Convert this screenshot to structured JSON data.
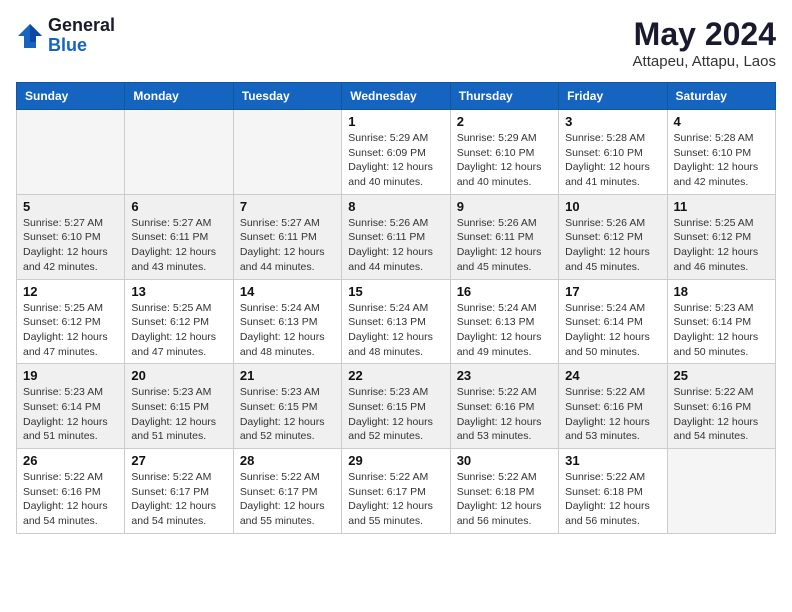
{
  "logo": {
    "general": "General",
    "blue": "Blue"
  },
  "title": "May 2024",
  "subtitle": "Attapeu, Attapu, Laos",
  "days_header": [
    "Sunday",
    "Monday",
    "Tuesday",
    "Wednesday",
    "Thursday",
    "Friday",
    "Saturday"
  ],
  "weeks": [
    [
      {
        "day": "",
        "info": ""
      },
      {
        "day": "",
        "info": ""
      },
      {
        "day": "",
        "info": ""
      },
      {
        "day": "1",
        "info": "Sunrise: 5:29 AM\nSunset: 6:09 PM\nDaylight: 12 hours\nand 40 minutes."
      },
      {
        "day": "2",
        "info": "Sunrise: 5:29 AM\nSunset: 6:10 PM\nDaylight: 12 hours\nand 40 minutes."
      },
      {
        "day": "3",
        "info": "Sunrise: 5:28 AM\nSunset: 6:10 PM\nDaylight: 12 hours\nand 41 minutes."
      },
      {
        "day": "4",
        "info": "Sunrise: 5:28 AM\nSunset: 6:10 PM\nDaylight: 12 hours\nand 42 minutes."
      }
    ],
    [
      {
        "day": "5",
        "info": "Sunrise: 5:27 AM\nSunset: 6:10 PM\nDaylight: 12 hours\nand 42 minutes."
      },
      {
        "day": "6",
        "info": "Sunrise: 5:27 AM\nSunset: 6:11 PM\nDaylight: 12 hours\nand 43 minutes."
      },
      {
        "day": "7",
        "info": "Sunrise: 5:27 AM\nSunset: 6:11 PM\nDaylight: 12 hours\nand 44 minutes."
      },
      {
        "day": "8",
        "info": "Sunrise: 5:26 AM\nSunset: 6:11 PM\nDaylight: 12 hours\nand 44 minutes."
      },
      {
        "day": "9",
        "info": "Sunrise: 5:26 AM\nSunset: 6:11 PM\nDaylight: 12 hours\nand 45 minutes."
      },
      {
        "day": "10",
        "info": "Sunrise: 5:26 AM\nSunset: 6:12 PM\nDaylight: 12 hours\nand 45 minutes."
      },
      {
        "day": "11",
        "info": "Sunrise: 5:25 AM\nSunset: 6:12 PM\nDaylight: 12 hours\nand 46 minutes."
      }
    ],
    [
      {
        "day": "12",
        "info": "Sunrise: 5:25 AM\nSunset: 6:12 PM\nDaylight: 12 hours\nand 47 minutes."
      },
      {
        "day": "13",
        "info": "Sunrise: 5:25 AM\nSunset: 6:12 PM\nDaylight: 12 hours\nand 47 minutes."
      },
      {
        "day": "14",
        "info": "Sunrise: 5:24 AM\nSunset: 6:13 PM\nDaylight: 12 hours\nand 48 minutes."
      },
      {
        "day": "15",
        "info": "Sunrise: 5:24 AM\nSunset: 6:13 PM\nDaylight: 12 hours\nand 48 minutes."
      },
      {
        "day": "16",
        "info": "Sunrise: 5:24 AM\nSunset: 6:13 PM\nDaylight: 12 hours\nand 49 minutes."
      },
      {
        "day": "17",
        "info": "Sunrise: 5:24 AM\nSunset: 6:14 PM\nDaylight: 12 hours\nand 50 minutes."
      },
      {
        "day": "18",
        "info": "Sunrise: 5:23 AM\nSunset: 6:14 PM\nDaylight: 12 hours\nand 50 minutes."
      }
    ],
    [
      {
        "day": "19",
        "info": "Sunrise: 5:23 AM\nSunset: 6:14 PM\nDaylight: 12 hours\nand 51 minutes."
      },
      {
        "day": "20",
        "info": "Sunrise: 5:23 AM\nSunset: 6:15 PM\nDaylight: 12 hours\nand 51 minutes."
      },
      {
        "day": "21",
        "info": "Sunrise: 5:23 AM\nSunset: 6:15 PM\nDaylight: 12 hours\nand 52 minutes."
      },
      {
        "day": "22",
        "info": "Sunrise: 5:23 AM\nSunset: 6:15 PM\nDaylight: 12 hours\nand 52 minutes."
      },
      {
        "day": "23",
        "info": "Sunrise: 5:22 AM\nSunset: 6:16 PM\nDaylight: 12 hours\nand 53 minutes."
      },
      {
        "day": "24",
        "info": "Sunrise: 5:22 AM\nSunset: 6:16 PM\nDaylight: 12 hours\nand 53 minutes."
      },
      {
        "day": "25",
        "info": "Sunrise: 5:22 AM\nSunset: 6:16 PM\nDaylight: 12 hours\nand 54 minutes."
      }
    ],
    [
      {
        "day": "26",
        "info": "Sunrise: 5:22 AM\nSunset: 6:16 PM\nDaylight: 12 hours\nand 54 minutes."
      },
      {
        "day": "27",
        "info": "Sunrise: 5:22 AM\nSunset: 6:17 PM\nDaylight: 12 hours\nand 54 minutes."
      },
      {
        "day": "28",
        "info": "Sunrise: 5:22 AM\nSunset: 6:17 PM\nDaylight: 12 hours\nand 55 minutes."
      },
      {
        "day": "29",
        "info": "Sunrise: 5:22 AM\nSunset: 6:17 PM\nDaylight: 12 hours\nand 55 minutes."
      },
      {
        "day": "30",
        "info": "Sunrise: 5:22 AM\nSunset: 6:18 PM\nDaylight: 12 hours\nand 56 minutes."
      },
      {
        "day": "31",
        "info": "Sunrise: 5:22 AM\nSunset: 6:18 PM\nDaylight: 12 hours\nand 56 minutes."
      },
      {
        "day": "",
        "info": ""
      }
    ]
  ]
}
